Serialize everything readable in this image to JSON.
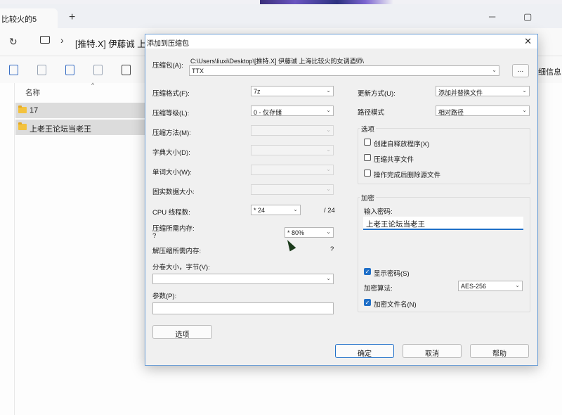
{
  "explorer": {
    "tab_title": "比较火的5",
    "address_path": "[推特.X] 伊藤诚 上海",
    "details_label": "细信息",
    "column_name": "名称",
    "files": [
      {
        "name": "17"
      },
      {
        "name": "上老王论坛当老王"
      }
    ]
  },
  "dialog": {
    "title": "添加到压缩包",
    "archive_label": "压缩包(A):",
    "archive_path": "C:\\Users\\liuxi\\Desktop\\[推特.X] 伊藤诚 上海比较火的女调酒师\\",
    "archive_name": "TTX",
    "browse_label": "...",
    "format_label": "压缩格式(F):",
    "format_value": "7z",
    "level_label": "压缩等级(L):",
    "level_value": "0 - 仅存储",
    "method_label": "压缩方法(M):",
    "dict_label": "字典大小(D):",
    "word_label": "单词大小(W):",
    "solid_label": "固实数据大小:",
    "cpu_label": "CPU 线程数:",
    "cpu_value": "* 24",
    "cpu_max": "/ 24",
    "mem_label": "压缩所需内存:",
    "mem_q": "?",
    "mem_value": "* 80%",
    "demem_label": "解压缩所需内存:",
    "demem_q": "?",
    "split_label": "分卷大小，字节(V):",
    "param_label": "参数(P):",
    "options_btn": "选项",
    "update_label": "更新方式(U):",
    "update_value": "添加并替换文件",
    "path_label": "路径模式",
    "path_value": "相对路径",
    "options_group": "选项",
    "opt_sfx": "创建自释放程序(X)",
    "opt_shared": "压缩共享文件",
    "opt_delete": "操作完成后删除源文件",
    "encrypt_group": "加密",
    "pw_label": "输入密码:",
    "pw_value": "上老王论坛当老王",
    "show_pw": "显示密码(S)",
    "algo_label": "加密算法:",
    "algo_value": "AES-256",
    "encrypt_names": "加密文件名(N)",
    "ok": "确定",
    "cancel": "取消",
    "help": "帮助"
  }
}
